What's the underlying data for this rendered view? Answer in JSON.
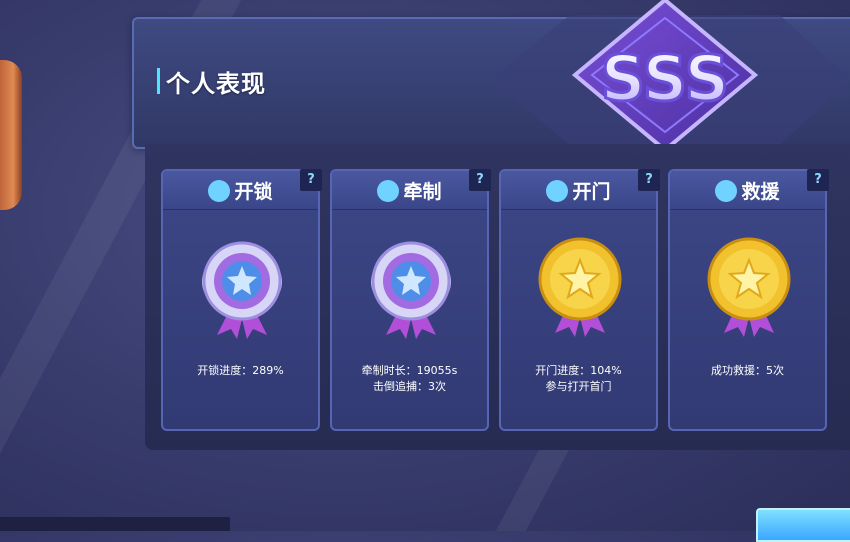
{
  "panel": {
    "title": "个人表现"
  },
  "rank_badge": {
    "text": "SSS"
  },
  "cards": [
    {
      "title": "开锁",
      "icon": "key-icon",
      "medal": "silver-star-medal",
      "lines": [
        "开锁进度：289%"
      ]
    },
    {
      "title": "牵制",
      "icon": "person-icon",
      "medal": "silver-star-medal",
      "lines": [
        "牵制时长：19055s",
        "击倒追捕：3次"
      ]
    },
    {
      "title": "开门",
      "icon": "door-icon",
      "medal": "gold-star-medal",
      "lines": [
        "开门进度：104%",
        "参与打开首门"
      ]
    },
    {
      "title": "救援",
      "icon": "rescue-icon",
      "medal": "gold-star-medal",
      "lines": [
        "成功救援：5次"
      ]
    }
  ],
  "help_label": "?",
  "colors": {
    "accent": "#4fe3ff",
    "card": "#3c4786",
    "gold": "#f2c12e",
    "silver": "#c9c6f2",
    "purple": "#9b5de5"
  }
}
